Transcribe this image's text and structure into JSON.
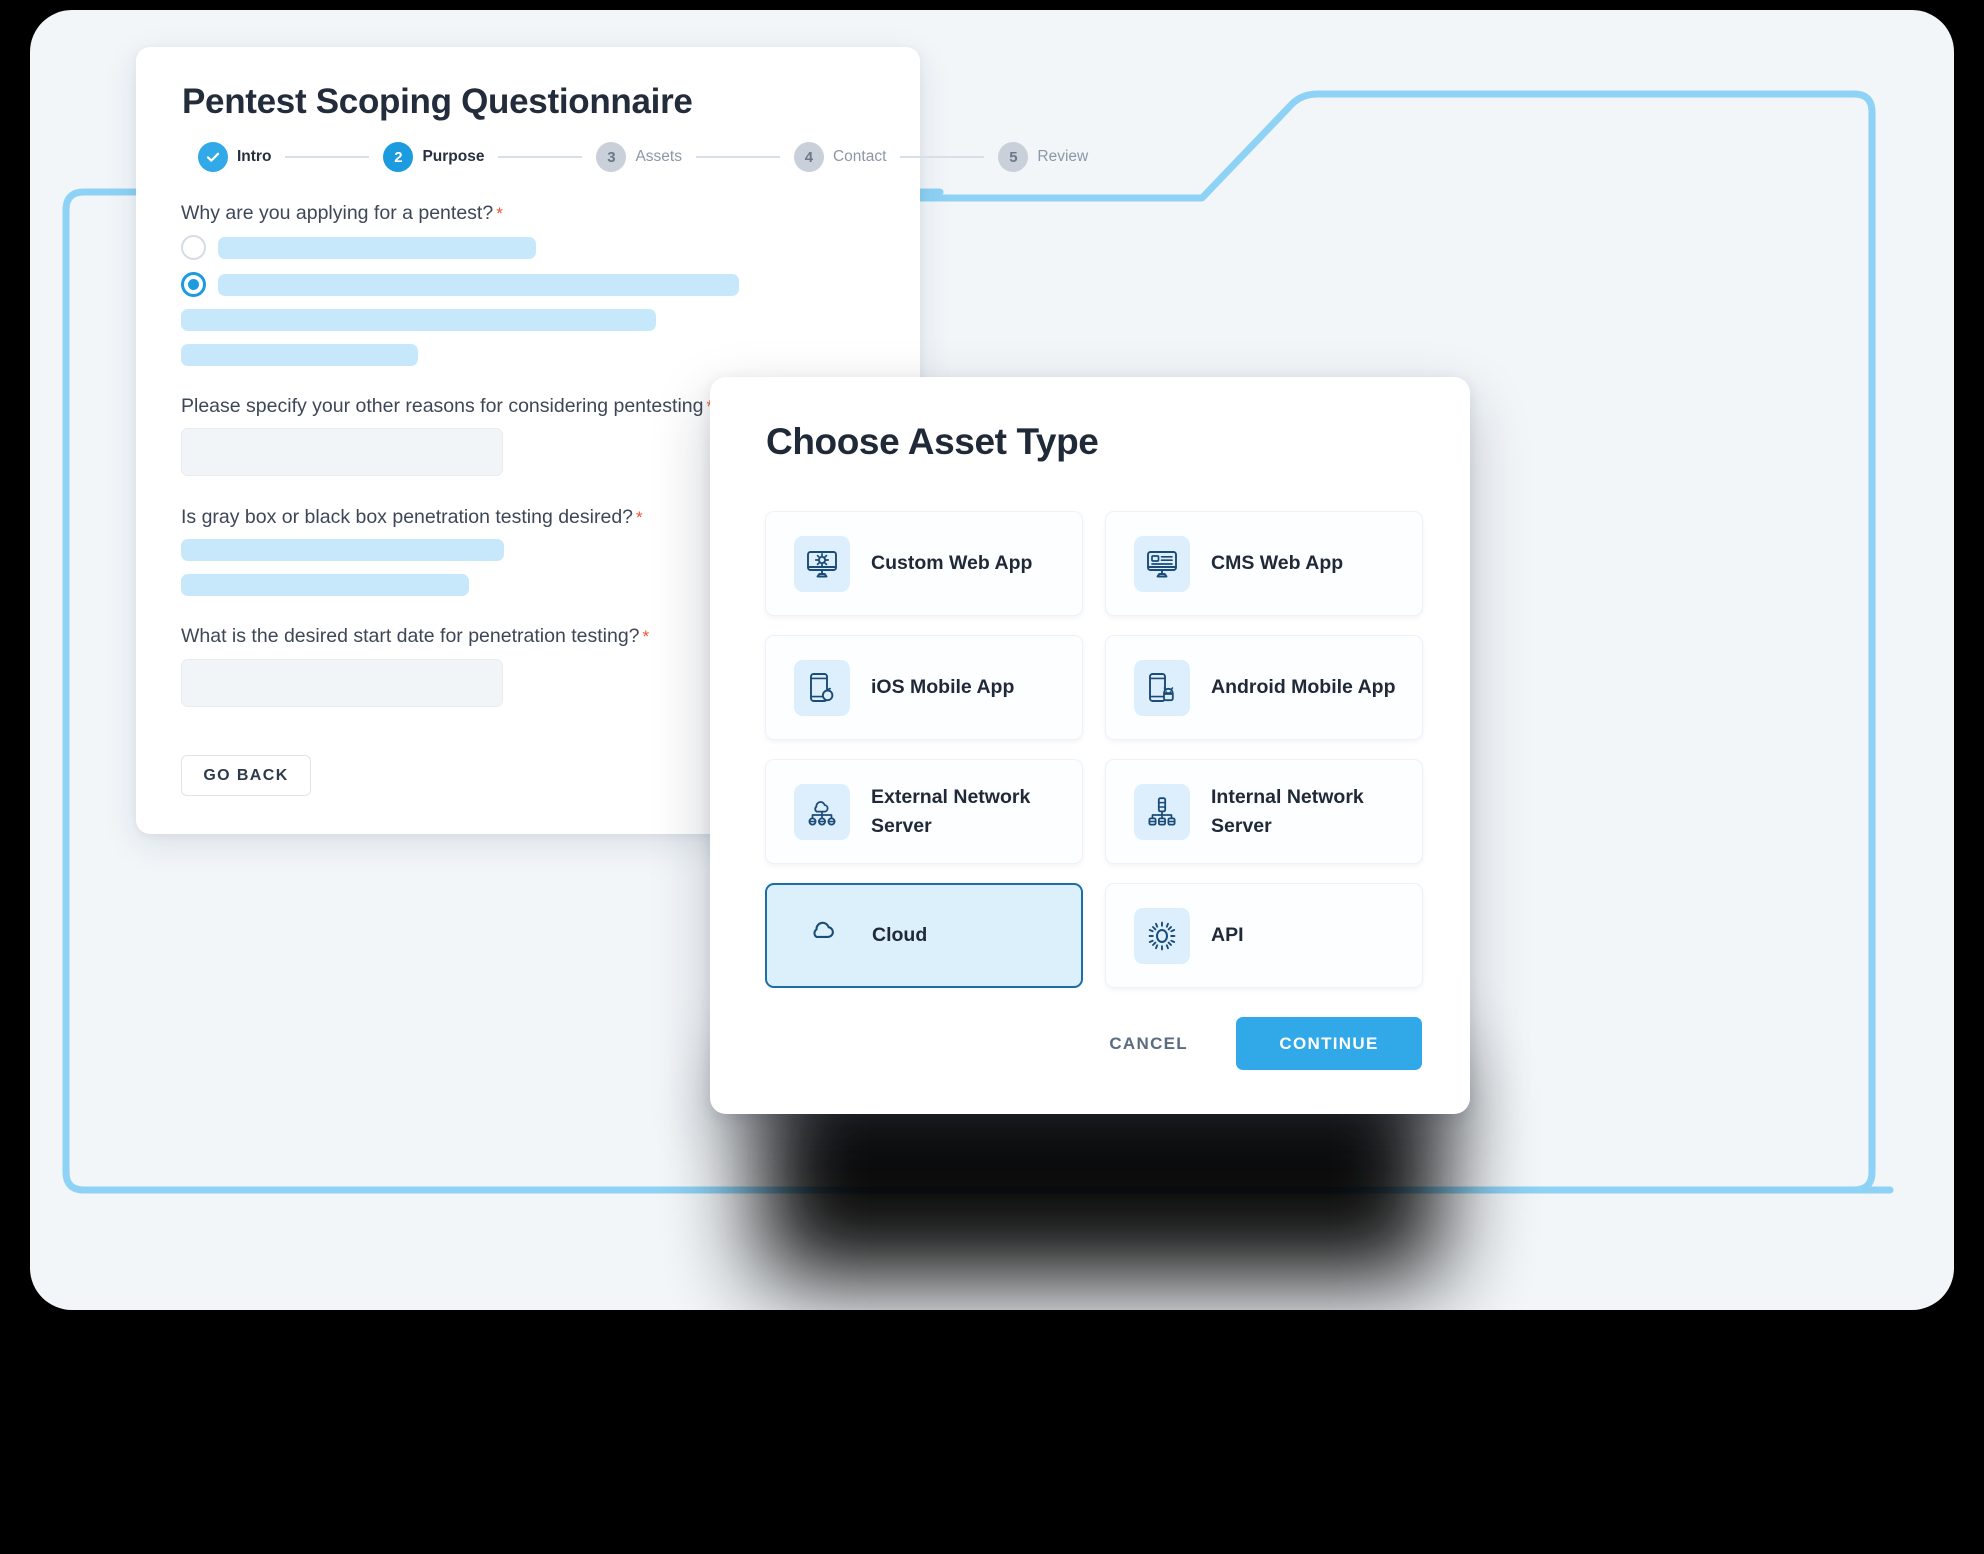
{
  "colors": {
    "page_background": "#000000",
    "canvas_background": "#f2f6f9",
    "accent_blue": "#31a8e8",
    "active_step_blue": "#1c9bdf",
    "deco_line_blue": "#8ed2f5",
    "skeleton_blue": "#c7e7fb",
    "icon_navy": "#1b4b77",
    "icon_tile_blue": "#ddeffc",
    "selected_card_fill": "#dcf0fc",
    "selected_card_border": "#1b6ea8",
    "required_asterisk": "#f0532f",
    "heading_text": "#232c3b",
    "muted_text": "#8c97a6"
  },
  "form": {
    "title": "Pentest Scoping Questionnaire",
    "steps": [
      {
        "badge": "check-icon",
        "number": "",
        "label": "Intro",
        "state": "done"
      },
      {
        "badge": "number",
        "number": "2",
        "label": "Purpose",
        "state": "active"
      },
      {
        "badge": "number",
        "number": "3",
        "label": "Assets",
        "state": "idle"
      },
      {
        "badge": "number",
        "number": "4",
        "label": "Contact",
        "state": "idle"
      },
      {
        "badge": "number",
        "number": "5",
        "label": "Review",
        "state": "idle"
      }
    ],
    "questions": [
      {
        "label": "Why are you applying for a pentest?",
        "required": "*"
      },
      {
        "label": "Please specify your other reasons for considering pentesting",
        "required": "*"
      },
      {
        "label": "Is gray box or black box penetration testing desired?",
        "required": "*"
      },
      {
        "label": "What is the desired start date for penetration testing?",
        "required": "*"
      }
    ],
    "inputs": {
      "other_reasons_value": "",
      "other_reasons_placeholder": "",
      "start_date_value": "",
      "start_date_placeholder": ""
    },
    "go_back_label": "GO BACK"
  },
  "modal": {
    "title": "Choose Asset Type",
    "asset_types": [
      {
        "label": "Custom Web App",
        "icon": "monitor-gear-icon",
        "selected": false
      },
      {
        "label": "CMS Web App",
        "icon": "monitor-content-icon",
        "selected": false
      },
      {
        "label": "iOS Mobile App",
        "icon": "phone-apple-icon",
        "selected": false
      },
      {
        "label": "Android Mobile App",
        "icon": "phone-android-icon",
        "selected": false
      },
      {
        "label": "External Network Server",
        "icon": "cloud-servers-icon",
        "selected": false
      },
      {
        "label": "Internal Network Server",
        "icon": "server-network-icon",
        "selected": false
      },
      {
        "label": "Cloud",
        "icon": "cloud-icon",
        "selected": true
      },
      {
        "label": "API",
        "icon": "gear-icon",
        "selected": false
      }
    ],
    "cancel_label": "CANCEL",
    "continue_label": "CONTINUE"
  }
}
